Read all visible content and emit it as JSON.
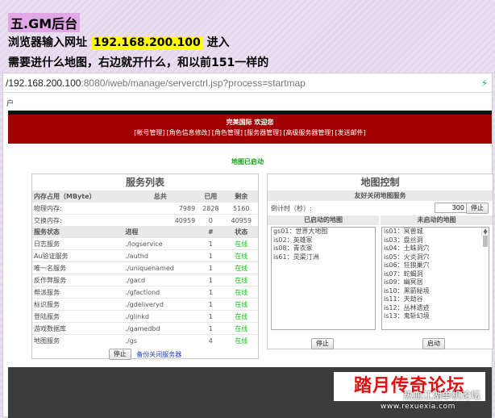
{
  "slide": {
    "heading": "五.GM后台",
    "line1_prefix": "浏览器输入网址",
    "line1_ip": "192.168.200.100",
    "line1_suffix": "进入",
    "line2": "需要进什么地图，右边就开什么，和以前151一样的"
  },
  "browser": {
    "address_host": "/192.168.200.100",
    "address_rest": ":8080/iweb/manage/serverctrl.jsp?process=startmap",
    "bookmark_fragment": "户",
    "reload_icon": "reload-icon"
  },
  "banner": {
    "welcome": "完美国际 欢迎您",
    "nav": [
      "帐号管理",
      "角色信息修改",
      "角色管理",
      "服务器管理",
      "高级服务器管理",
      "发送邮件"
    ]
  },
  "status_message": "地图已启动",
  "service_panel": {
    "title": "服务列表",
    "memory_header": [
      "内存占用（MByte）",
      "总共",
      "已用",
      "剩余"
    ],
    "memory_rows": [
      [
        "物理内存:",
        "7989",
        "2828",
        "5160"
      ],
      [
        "交换内存:",
        "40959",
        "0",
        "40959"
      ]
    ],
    "service_header": [
      "服务状态",
      "进程",
      "#",
      "状态"
    ],
    "services": [
      {
        "name": "日志服务",
        "process": "./logservice",
        "count": "1",
        "status": "在线"
      },
      {
        "name": "Au验证服务",
        "process": "./authd",
        "count": "1",
        "status": "在线"
      },
      {
        "name": "唯一名服务",
        "process": "./uniquenamed",
        "count": "1",
        "status": "在线"
      },
      {
        "name": "反作弊服务",
        "process": "./gacd",
        "count": "1",
        "status": "在线"
      },
      {
        "name": "帮派服务",
        "process": "./gfactiond",
        "count": "1",
        "status": "在线"
      },
      {
        "name": "标识服务",
        "process": "./gdeliveryd",
        "count": "1",
        "status": "在线"
      },
      {
        "name": "登陆服务",
        "process": "./glinkd",
        "count": "1",
        "status": "在线"
      },
      {
        "name": "游戏数据库",
        "process": "./gamedbd",
        "count": "1",
        "status": "在线"
      },
      {
        "name": "地图服务",
        "process": "./gs",
        "count": "4",
        "status": "在线"
      }
    ],
    "stop_button": "停止",
    "backup_link": "备份关闭服务器"
  },
  "map_panel": {
    "title": "地图控制",
    "friendly_close": "友好关闭地图服务",
    "countdown_label": "倒计时（秒）:",
    "countdown_value": "300",
    "countdown_stop": "停止",
    "started_head": "已启动的地图",
    "not_started_head": "未启动的地图",
    "started": [
      "gs01：世界大地图",
      "is02：英雄冢",
      "is08：青衣冢",
      "is61：灵渠汀洲"
    ],
    "not_started": [
      "is01：冥兽城",
      "is03：盘丝洞",
      "is04：土蛛洞穴",
      "is05：火炎洞穴",
      "is06：狂狼巢穴",
      "is07：蛇蝎洞",
      "is09：幽冥居",
      "is10：黑箭秘境",
      "is11：天劫谷",
      "is12：丛林遗迹",
      "is13：鬼斩幻境"
    ],
    "stop_button": "停止",
    "start_button": "启动"
  },
  "footer": {
    "logo": "踏月传奇论坛",
    "watermark_cn": "热血江湖单机论坛",
    "watermark_url": "www.rexuexia.com"
  }
}
